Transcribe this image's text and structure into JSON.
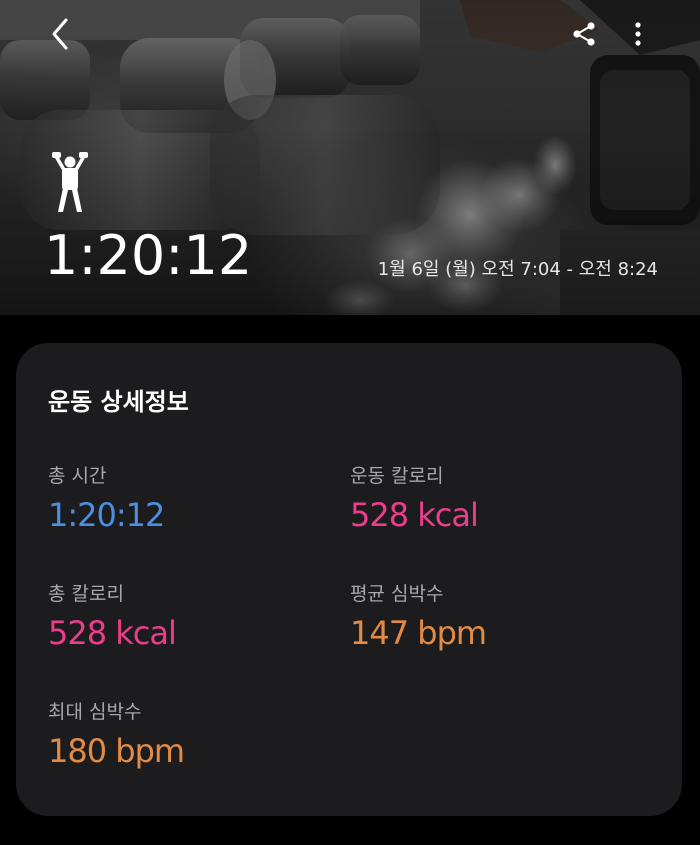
{
  "header": {
    "duration": "1:20:12",
    "date_range": "1월 6일 (월) 오전 7:04 - 오전 8:24",
    "back_icon": "chevron-left-icon",
    "share_icon": "share-icon",
    "more_icon": "more-vertical-icon",
    "workout_icon": "weightlifting-person-icon"
  },
  "card": {
    "title": "운동 상세정보",
    "stats": [
      {
        "label": "총 시간",
        "value": "1:20:12",
        "color": "#4b8fe2"
      },
      {
        "label": "운동 칼로리",
        "value": "528 kcal",
        "color": "#ea3d8a"
      },
      {
        "label": "총 칼로리",
        "value": "528 kcal",
        "color": "#ea3d8a"
      },
      {
        "label": "평균 심박수",
        "value": "147 bpm",
        "color": "#e38b45"
      },
      {
        "label": "최대 심박수",
        "value": "180 bpm",
        "color": "#e38b45"
      }
    ]
  }
}
